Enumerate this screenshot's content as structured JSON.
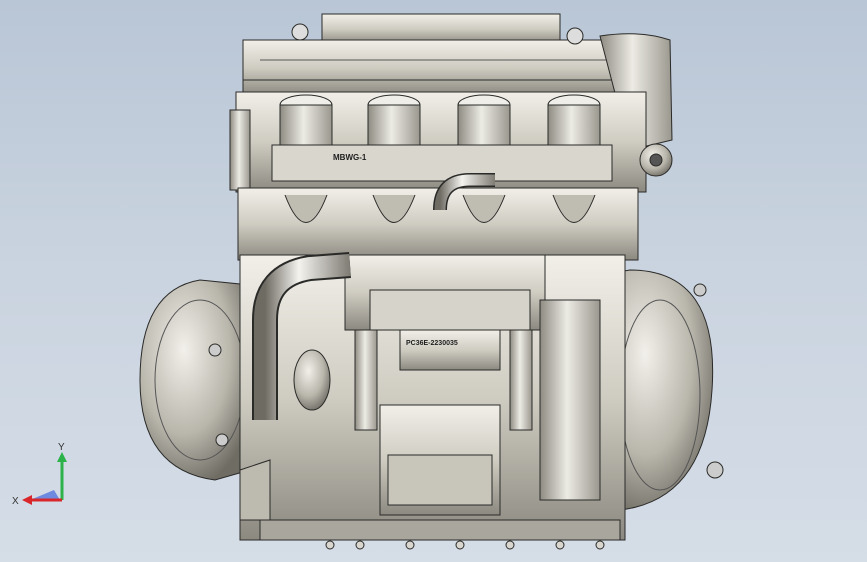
{
  "engraving": {
    "cylinder_head_mark": "MBWG-1",
    "case_serial": "PC36E-2230035"
  },
  "triad": {
    "x_label": "X",
    "y_label": "Y",
    "colors": {
      "x": "#d9262a",
      "y": "#2bb34a",
      "z": "#2c54d8"
    }
  },
  "colors": {
    "background_top": "#b9c6d6",
    "background_bottom": "#d5dde7",
    "metal_light": "#e9e7df",
    "metal_mid": "#c8c5bb",
    "metal_dark": "#7d7a72",
    "edge": "#2a2a28"
  }
}
